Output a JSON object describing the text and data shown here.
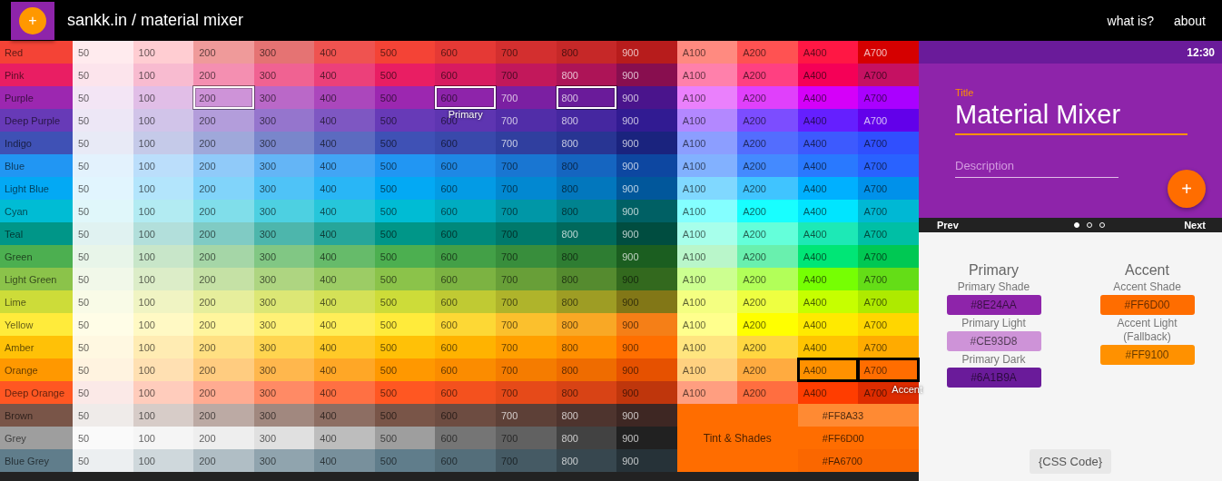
{
  "header": {
    "logo_symbol": "+",
    "title": "sankk.in / material mixer",
    "links": [
      {
        "label": "what is?"
      },
      {
        "label": "about"
      }
    ]
  },
  "palette_grid": {
    "rows": [
      {
        "name": "Red",
        "color": "#f44336",
        "shades": [
          {
            "label": "50",
            "color": "#ffebee",
            "selected": false
          },
          {
            "label": "100",
            "color": "#ffcdd2",
            "selected": false
          },
          {
            "label": "200",
            "color": "#ef9a9a",
            "selected": false
          },
          {
            "label": "300",
            "color": "#e57373",
            "selected": false
          },
          {
            "label": "400",
            "color": "#ef5350",
            "selected": false
          },
          {
            "label": "500",
            "color": "#f44336",
            "selected": false
          },
          {
            "label": "600",
            "color": "#e53935",
            "selected": false
          },
          {
            "label": "700",
            "color": "#d32f2f",
            "selected": false
          },
          {
            "label": "800",
            "color": "#c62828",
            "selected": false
          },
          {
            "label": "900",
            "color": "#b71c1c",
            "selected": false
          }
        ],
        "accents": [
          {
            "label": "A100",
            "color": "#ff8a80",
            "selected": false
          },
          {
            "label": "A200",
            "color": "#ff5252",
            "selected": false
          },
          {
            "label": "A400",
            "color": "#ff1744",
            "selected": false
          },
          {
            "label": "A700",
            "color": "#d50000",
            "selected": false
          }
        ]
      },
      {
        "name": "Pink",
        "color": "#e91e63",
        "shades": [
          {
            "label": "50",
            "color": "#fce4ec",
            "selected": false
          },
          {
            "label": "100",
            "color": "#f8bbd0",
            "selected": false
          },
          {
            "label": "200",
            "color": "#f48fb1",
            "selected": false
          },
          {
            "label": "300",
            "color": "#f06292",
            "selected": false
          },
          {
            "label": "400",
            "color": "#ec407a",
            "selected": false
          },
          {
            "label": "500",
            "color": "#e91e63",
            "selected": false
          },
          {
            "label": "600",
            "color": "#d81b60",
            "selected": false
          },
          {
            "label": "700",
            "color": "#c2185b",
            "selected": false
          },
          {
            "label": "800",
            "color": "#ad1457",
            "selected": false
          },
          {
            "label": "900",
            "color": "#880e4f",
            "selected": false
          }
        ],
        "accents": [
          {
            "label": "A100",
            "color": "#ff80ab",
            "selected": false
          },
          {
            "label": "A200",
            "color": "#ff4081",
            "selected": false
          },
          {
            "label": "A400",
            "color": "#f50057",
            "selected": false
          },
          {
            "label": "A700",
            "color": "#c51162",
            "selected": false
          }
        ]
      },
      {
        "name": "Purple",
        "color": "#9c27b0",
        "shades": [
          {
            "label": "50",
            "color": "#f3e5f5",
            "selected": false
          },
          {
            "label": "100",
            "color": "#e1bee7",
            "selected": false
          },
          {
            "label": "200",
            "color": "#ce93d8",
            "selected": true
          },
          {
            "label": "300",
            "color": "#ba68c8",
            "selected": false
          },
          {
            "label": "400",
            "color": "#ab47bc",
            "selected": false
          },
          {
            "label": "500",
            "color": "#9c27b0",
            "selected": false
          },
          {
            "label": "600",
            "color": "#8e24aa",
            "selected": true,
            "tag": "Primary"
          },
          {
            "label": "700",
            "color": "#7b1fa2",
            "selected": false
          },
          {
            "label": "800",
            "color": "#6a1b9a",
            "selected": true
          },
          {
            "label": "900",
            "color": "#4a148c",
            "selected": false
          }
        ],
        "accents": [
          {
            "label": "A100",
            "color": "#ea80fc",
            "selected": false
          },
          {
            "label": "A200",
            "color": "#e040fb",
            "selected": false
          },
          {
            "label": "A400",
            "color": "#d500f9",
            "selected": false
          },
          {
            "label": "A700",
            "color": "#aa00ff",
            "selected": false
          }
        ]
      },
      {
        "name": "Deep Purple",
        "color": "#673ab7",
        "shades": [
          {
            "label": "50",
            "color": "#ede7f6",
            "selected": false
          },
          {
            "label": "100",
            "color": "#d1c4e9",
            "selected": false
          },
          {
            "label": "200",
            "color": "#b39ddb",
            "selected": false
          },
          {
            "label": "300",
            "color": "#9575cd",
            "selected": false
          },
          {
            "label": "400",
            "color": "#7e57c2",
            "selected": false
          },
          {
            "label": "500",
            "color": "#673ab7",
            "selected": false
          },
          {
            "label": "600",
            "color": "#5e35b1",
            "selected": false
          },
          {
            "label": "700",
            "color": "#512da8",
            "selected": false
          },
          {
            "label": "800",
            "color": "#4527a0",
            "selected": false
          },
          {
            "label": "900",
            "color": "#311b92",
            "selected": false
          }
        ],
        "accents": [
          {
            "label": "A100",
            "color": "#b388ff",
            "selected": false
          },
          {
            "label": "A200",
            "color": "#7c4dff",
            "selected": false
          },
          {
            "label": "A400",
            "color": "#651fff",
            "selected": false
          },
          {
            "label": "A700",
            "color": "#6200ea",
            "selected": false
          }
        ]
      },
      {
        "name": "Indigo",
        "color": "#3f51b5",
        "shades": [
          {
            "label": "50",
            "color": "#e8eaf6",
            "selected": false
          },
          {
            "label": "100",
            "color": "#c5cae9",
            "selected": false
          },
          {
            "label": "200",
            "color": "#9fa8da",
            "selected": false
          },
          {
            "label": "300",
            "color": "#7986cb",
            "selected": false
          },
          {
            "label": "400",
            "color": "#5c6bc0",
            "selected": false
          },
          {
            "label": "500",
            "color": "#3f51b5",
            "selected": false
          },
          {
            "label": "600",
            "color": "#3949ab",
            "selected": false
          },
          {
            "label": "700",
            "color": "#303f9f",
            "selected": false
          },
          {
            "label": "800",
            "color": "#283593",
            "selected": false
          },
          {
            "label": "900",
            "color": "#1a237e",
            "selected": false
          }
        ],
        "accents": [
          {
            "label": "A100",
            "color": "#8c9eff",
            "selected": false
          },
          {
            "label": "A200",
            "color": "#536dfe",
            "selected": false
          },
          {
            "label": "A400",
            "color": "#3d5afe",
            "selected": false
          },
          {
            "label": "A700",
            "color": "#304ffe",
            "selected": false
          }
        ]
      },
      {
        "name": "Blue",
        "color": "#2196f3",
        "shades": [
          {
            "label": "50",
            "color": "#e3f2fd",
            "selected": false
          },
          {
            "label": "100",
            "color": "#bbdefb",
            "selected": false
          },
          {
            "label": "200",
            "color": "#90caf9",
            "selected": false
          },
          {
            "label": "300",
            "color": "#64b5f6",
            "selected": false
          },
          {
            "label": "400",
            "color": "#42a5f5",
            "selected": false
          },
          {
            "label": "500",
            "color": "#2196f3",
            "selected": false
          },
          {
            "label": "600",
            "color": "#1e88e5",
            "selected": false
          },
          {
            "label": "700",
            "color": "#1976d2",
            "selected": false
          },
          {
            "label": "800",
            "color": "#1565c0",
            "selected": false
          },
          {
            "label": "900",
            "color": "#0d47a1",
            "selected": false
          }
        ],
        "accents": [
          {
            "label": "A100",
            "color": "#82b1ff",
            "selected": false
          },
          {
            "label": "A200",
            "color": "#448aff",
            "selected": false
          },
          {
            "label": "A400",
            "color": "#2979ff",
            "selected": false
          },
          {
            "label": "A700",
            "color": "#2962ff",
            "selected": false
          }
        ]
      },
      {
        "name": "Light Blue",
        "color": "#03a9f4",
        "shades": [
          {
            "label": "50",
            "color": "#e1f5fe",
            "selected": false
          },
          {
            "label": "100",
            "color": "#b3e5fc",
            "selected": false
          },
          {
            "label": "200",
            "color": "#81d4fa",
            "selected": false
          },
          {
            "label": "300",
            "color": "#4fc3f7",
            "selected": false
          },
          {
            "label": "400",
            "color": "#29b6f6",
            "selected": false
          },
          {
            "label": "500",
            "color": "#03a9f4",
            "selected": false
          },
          {
            "label": "600",
            "color": "#039be5",
            "selected": false
          },
          {
            "label": "700",
            "color": "#0288d1",
            "selected": false
          },
          {
            "label": "800",
            "color": "#0277bd",
            "selected": false
          },
          {
            "label": "900",
            "color": "#01579b",
            "selected": false
          }
        ],
        "accents": [
          {
            "label": "A100",
            "color": "#80d8ff",
            "selected": false
          },
          {
            "label": "A200",
            "color": "#40c4ff",
            "selected": false
          },
          {
            "label": "A400",
            "color": "#00b0ff",
            "selected": false
          },
          {
            "label": "A700",
            "color": "#0091ea",
            "selected": false
          }
        ]
      },
      {
        "name": "Cyan",
        "color": "#00bcd4",
        "shades": [
          {
            "label": "50",
            "color": "#e0f7fa",
            "selected": false
          },
          {
            "label": "100",
            "color": "#b2ebf2",
            "selected": false
          },
          {
            "label": "200",
            "color": "#80deea",
            "selected": false
          },
          {
            "label": "300",
            "color": "#4dd0e1",
            "selected": false
          },
          {
            "label": "400",
            "color": "#26c6da",
            "selected": false
          },
          {
            "label": "500",
            "color": "#00bcd4",
            "selected": false
          },
          {
            "label": "600",
            "color": "#00acc1",
            "selected": false
          },
          {
            "label": "700",
            "color": "#0097a7",
            "selected": false
          },
          {
            "label": "800",
            "color": "#00838f",
            "selected": false
          },
          {
            "label": "900",
            "color": "#006064",
            "selected": false
          }
        ],
        "accents": [
          {
            "label": "A100",
            "color": "#84ffff",
            "selected": false
          },
          {
            "label": "A200",
            "color": "#18ffff",
            "selected": false
          },
          {
            "label": "A400",
            "color": "#00e5ff",
            "selected": false
          },
          {
            "label": "A700",
            "color": "#00b8d4",
            "selected": false
          }
        ]
      },
      {
        "name": "Teal",
        "color": "#009688",
        "shades": [
          {
            "label": "50",
            "color": "#e0f2f1",
            "selected": false
          },
          {
            "label": "100",
            "color": "#b2dfdb",
            "selected": false
          },
          {
            "label": "200",
            "color": "#80cbc4",
            "selected": false
          },
          {
            "label": "300",
            "color": "#4db6ac",
            "selected": false
          },
          {
            "label": "400",
            "color": "#26a69a",
            "selected": false
          },
          {
            "label": "500",
            "color": "#009688",
            "selected": false
          },
          {
            "label": "600",
            "color": "#00897b",
            "selected": false
          },
          {
            "label": "700",
            "color": "#00796b",
            "selected": false
          },
          {
            "label": "800",
            "color": "#00695c",
            "selected": false
          },
          {
            "label": "900",
            "color": "#004d40",
            "selected": false
          }
        ],
        "accents": [
          {
            "label": "A100",
            "color": "#a7ffeb",
            "selected": false
          },
          {
            "label": "A200",
            "color": "#64ffda",
            "selected": false
          },
          {
            "label": "A400",
            "color": "#1de9b6",
            "selected": false
          },
          {
            "label": "A700",
            "color": "#00bfa5",
            "selected": false
          }
        ]
      },
      {
        "name": "Green",
        "color": "#4caf50",
        "shades": [
          {
            "label": "50",
            "color": "#e8f5e9",
            "selected": false
          },
          {
            "label": "100",
            "color": "#c8e6c9",
            "selected": false
          },
          {
            "label": "200",
            "color": "#a5d6a7",
            "selected": false
          },
          {
            "label": "300",
            "color": "#81c784",
            "selected": false
          },
          {
            "label": "400",
            "color": "#66bb6a",
            "selected": false
          },
          {
            "label": "500",
            "color": "#4caf50",
            "selected": false
          },
          {
            "label": "600",
            "color": "#43a047",
            "selected": false
          },
          {
            "label": "700",
            "color": "#388e3c",
            "selected": false
          },
          {
            "label": "800",
            "color": "#2e7d32",
            "selected": false
          },
          {
            "label": "900",
            "color": "#1b5e20",
            "selected": false
          }
        ],
        "accents": [
          {
            "label": "A100",
            "color": "#b9f6ca",
            "selected": false
          },
          {
            "label": "A200",
            "color": "#69f0ae",
            "selected": false
          },
          {
            "label": "A400",
            "color": "#00e676",
            "selected": false
          },
          {
            "label": "A700",
            "color": "#00c853",
            "selected": false
          }
        ]
      },
      {
        "name": "Light Green",
        "color": "#8bc34a",
        "shades": [
          {
            "label": "50",
            "color": "#f1f8e9",
            "selected": false
          },
          {
            "label": "100",
            "color": "#dcedc8",
            "selected": false
          },
          {
            "label": "200",
            "color": "#c5e1a5",
            "selected": false
          },
          {
            "label": "300",
            "color": "#aed581",
            "selected": false
          },
          {
            "label": "400",
            "color": "#9ccc65",
            "selected": false
          },
          {
            "label": "500",
            "color": "#8bc34a",
            "selected": false
          },
          {
            "label": "600",
            "color": "#7cb342",
            "selected": false
          },
          {
            "label": "700",
            "color": "#689f38",
            "selected": false
          },
          {
            "label": "800",
            "color": "#558b2f",
            "selected": false
          },
          {
            "label": "900",
            "color": "#33691e",
            "selected": false
          }
        ],
        "accents": [
          {
            "label": "A100",
            "color": "#ccff90",
            "selected": false
          },
          {
            "label": "A200",
            "color": "#b2ff59",
            "selected": false
          },
          {
            "label": "A400",
            "color": "#76ff03",
            "selected": false
          },
          {
            "label": "A700",
            "color": "#64dd17",
            "selected": false
          }
        ]
      },
      {
        "name": "Lime",
        "color": "#cddc39",
        "shades": [
          {
            "label": "50",
            "color": "#f9fbe7",
            "selected": false
          },
          {
            "label": "100",
            "color": "#f0f4c3",
            "selected": false
          },
          {
            "label": "200",
            "color": "#e6ee9c",
            "selected": false
          },
          {
            "label": "300",
            "color": "#dce775",
            "selected": false
          },
          {
            "label": "400",
            "color": "#d4e157",
            "selected": false
          },
          {
            "label": "500",
            "color": "#cddc39",
            "selected": false
          },
          {
            "label": "600",
            "color": "#c0ca33",
            "selected": false
          },
          {
            "label": "700",
            "color": "#afb42b",
            "selected": false
          },
          {
            "label": "800",
            "color": "#9e9d24",
            "selected": false
          },
          {
            "label": "900",
            "color": "#827717",
            "selected": false
          }
        ],
        "accents": [
          {
            "label": "A100",
            "color": "#f4ff81",
            "selected": false
          },
          {
            "label": "A200",
            "color": "#eeff41",
            "selected": false
          },
          {
            "label": "A400",
            "color": "#c6ff00",
            "selected": false
          },
          {
            "label": "A700",
            "color": "#aeea00",
            "selected": false
          }
        ]
      },
      {
        "name": "Yellow",
        "color": "#ffeb3b",
        "shades": [
          {
            "label": "50",
            "color": "#fffde7",
            "selected": false
          },
          {
            "label": "100",
            "color": "#fff9c4",
            "selected": false
          },
          {
            "label": "200",
            "color": "#fff59d",
            "selected": false
          },
          {
            "label": "300",
            "color": "#fff176",
            "selected": false
          },
          {
            "label": "400",
            "color": "#ffee58",
            "selected": false
          },
          {
            "label": "500",
            "color": "#ffeb3b",
            "selected": false
          },
          {
            "label": "600",
            "color": "#fdd835",
            "selected": false
          },
          {
            "label": "700",
            "color": "#fbc02d",
            "selected": false
          },
          {
            "label": "800",
            "color": "#f9a825",
            "selected": false
          },
          {
            "label": "900",
            "color": "#f57f17",
            "selected": false
          }
        ],
        "accents": [
          {
            "label": "A100",
            "color": "#ffff8d",
            "selected": false
          },
          {
            "label": "A200",
            "color": "#ffff00",
            "selected": false
          },
          {
            "label": "A400",
            "color": "#ffea00",
            "selected": false
          },
          {
            "label": "A700",
            "color": "#ffd600",
            "selected": false
          }
        ]
      },
      {
        "name": "Amber",
        "color": "#ffc107",
        "shades": [
          {
            "label": "50",
            "color": "#fff8e1",
            "selected": false
          },
          {
            "label": "100",
            "color": "#ffecb3",
            "selected": false
          },
          {
            "label": "200",
            "color": "#ffe082",
            "selected": false
          },
          {
            "label": "300",
            "color": "#ffd54f",
            "selected": false
          },
          {
            "label": "400",
            "color": "#ffca28",
            "selected": false
          },
          {
            "label": "500",
            "color": "#ffc107",
            "selected": false
          },
          {
            "label": "600",
            "color": "#ffb300",
            "selected": false
          },
          {
            "label": "700",
            "color": "#ffa000",
            "selected": false
          },
          {
            "label": "800",
            "color": "#ff8f00",
            "selected": false
          },
          {
            "label": "900",
            "color": "#ff6f00",
            "selected": false
          }
        ],
        "accents": [
          {
            "label": "A100",
            "color": "#ffe57f",
            "selected": false
          },
          {
            "label": "A200",
            "color": "#ffd740",
            "selected": false
          },
          {
            "label": "A400",
            "color": "#ffc400",
            "selected": false
          },
          {
            "label": "A700",
            "color": "#ffab00",
            "selected": false
          }
        ]
      },
      {
        "name": "Orange",
        "color": "#ff9800",
        "shades": [
          {
            "label": "50",
            "color": "#fff3e0",
            "selected": false
          },
          {
            "label": "100",
            "color": "#ffe0b2",
            "selected": false
          },
          {
            "label": "200",
            "color": "#ffcc80",
            "selected": false
          },
          {
            "label": "300",
            "color": "#ffb74d",
            "selected": false
          },
          {
            "label": "400",
            "color": "#ffa726",
            "selected": false
          },
          {
            "label": "500",
            "color": "#ff9800",
            "selected": false
          },
          {
            "label": "600",
            "color": "#fb8c00",
            "selected": false
          },
          {
            "label": "700",
            "color": "#f57c00",
            "selected": false
          },
          {
            "label": "800",
            "color": "#ef6c00",
            "selected": false
          },
          {
            "label": "900",
            "color": "#e65100",
            "selected": false
          }
        ],
        "accents": [
          {
            "label": "A100",
            "color": "#ffd180",
            "selected": false
          },
          {
            "label": "A200",
            "color": "#ffab40",
            "selected": false
          },
          {
            "label": "A400",
            "color": "#ff9100",
            "selected": true
          },
          {
            "label": "A700",
            "color": "#ff6d00",
            "selected": true,
            "tag": "Accent"
          }
        ]
      },
      {
        "name": "Deep Orange",
        "color": "#ff5722",
        "shades": [
          {
            "label": "50",
            "color": "#fbe9e7",
            "selected": false
          },
          {
            "label": "100",
            "color": "#ffccbc",
            "selected": false
          },
          {
            "label": "200",
            "color": "#ffab91",
            "selected": false
          },
          {
            "label": "300",
            "color": "#ff8a65",
            "selected": false
          },
          {
            "label": "400",
            "color": "#ff7043",
            "selected": false
          },
          {
            "label": "500",
            "color": "#ff5722",
            "selected": false
          },
          {
            "label": "600",
            "color": "#f4511e",
            "selected": false
          },
          {
            "label": "700",
            "color": "#e64a19",
            "selected": false
          },
          {
            "label": "800",
            "color": "#d84315",
            "selected": false
          },
          {
            "label": "900",
            "color": "#bf360c",
            "selected": false
          }
        ],
        "accents": [
          {
            "label": "A100",
            "color": "#ff9e80",
            "selected": false
          },
          {
            "label": "A200",
            "color": "#ff6e40",
            "selected": false
          },
          {
            "label": "A400",
            "color": "#ff3d00",
            "selected": false
          },
          {
            "label": "A700",
            "color": "#dd2c00",
            "selected": false
          }
        ]
      },
      {
        "name": "Brown",
        "color": "#795548",
        "shades": [
          {
            "label": "50",
            "color": "#efebe9",
            "selected": false
          },
          {
            "label": "100",
            "color": "#d7ccc8",
            "selected": false
          },
          {
            "label": "200",
            "color": "#bcaaa4",
            "selected": false
          },
          {
            "label": "300",
            "color": "#a1887f",
            "selected": false
          },
          {
            "label": "400",
            "color": "#8d6e63",
            "selected": false
          },
          {
            "label": "500",
            "color": "#795548",
            "selected": false
          },
          {
            "label": "600",
            "color": "#6d4c41",
            "selected": false
          },
          {
            "label": "700",
            "color": "#5d4037",
            "selected": false
          },
          {
            "label": "800",
            "color": "#4e342e",
            "selected": false
          },
          {
            "label": "900",
            "color": "#3e2723",
            "selected": false
          }
        ]
      },
      {
        "name": "Grey",
        "color": "#9e9e9e",
        "shades": [
          {
            "label": "50",
            "color": "#fafafa",
            "selected": false
          },
          {
            "label": "100",
            "color": "#f5f5f5",
            "selected": false
          },
          {
            "label": "200",
            "color": "#eeeeee",
            "selected": false
          },
          {
            "label": "300",
            "color": "#e0e0e0",
            "selected": false
          },
          {
            "label": "400",
            "color": "#bdbdbd",
            "selected": false
          },
          {
            "label": "500",
            "color": "#9e9e9e",
            "selected": false
          },
          {
            "label": "600",
            "color": "#757575",
            "selected": false
          },
          {
            "label": "700",
            "color": "#616161",
            "selected": false
          },
          {
            "label": "800",
            "color": "#424242",
            "selected": false
          },
          {
            "label": "900",
            "color": "#212121",
            "selected": false
          }
        ]
      },
      {
        "name": "Blue Grey",
        "color": "#607d8b",
        "shades": [
          {
            "label": "50",
            "color": "#eceff1",
            "selected": false
          },
          {
            "label": "100",
            "color": "#cfd8dc",
            "selected": false
          },
          {
            "label": "200",
            "color": "#b0bec5",
            "selected": false
          },
          {
            "label": "300",
            "color": "#90a4ae",
            "selected": false
          },
          {
            "label": "400",
            "color": "#78909c",
            "selected": false
          },
          {
            "label": "500",
            "color": "#607d8b",
            "selected": false
          },
          {
            "label": "600",
            "color": "#546e7a",
            "selected": false
          },
          {
            "label": "700",
            "color": "#455a64",
            "selected": false
          },
          {
            "label": "800",
            "color": "#37474f",
            "selected": false
          },
          {
            "label": "900",
            "color": "#263238",
            "selected": false
          }
        ]
      }
    ],
    "tint_panel": {
      "label": "Tint & Shades",
      "swatches": [
        {
          "hex": "#FF8A33",
          "color": "#ff8a33"
        },
        {
          "hex": "#FF6D00",
          "color": "#ff6d00"
        },
        {
          "hex": "#FA6700",
          "color": "#fa6700"
        }
      ]
    }
  },
  "preview": {
    "time": "12:30",
    "title_label": "Title",
    "title_value": "Material Mixer",
    "description_placeholder": "Description",
    "fab_symbol": "+",
    "prev": "Prev",
    "next": "Next",
    "dots": [
      {
        "selected": true
      },
      {
        "selected": false
      },
      {
        "selected": false
      }
    ]
  },
  "scheme": {
    "groups": [
      {
        "heading": "Primary",
        "entries": [
          {
            "label": "Primary Shade",
            "hex": "#8E24AA",
            "color": "#8e24aa"
          },
          {
            "label": "Primary Light",
            "hex": "#CE93D8",
            "color": "#ce93d8"
          },
          {
            "label": "Primary Dark",
            "hex": "#6A1B9A",
            "color": "#6a1b9a"
          }
        ]
      },
      {
        "heading": "Accent",
        "entries": [
          {
            "label": "Accent Shade",
            "hex": "#FF6D00",
            "color": "#ff6d00"
          },
          {
            "label": "Accent Light (Fallback)",
            "hex": "#FF9100",
            "color": "#ff9100"
          }
        ]
      }
    ],
    "css_button": "{CSS Code}"
  }
}
